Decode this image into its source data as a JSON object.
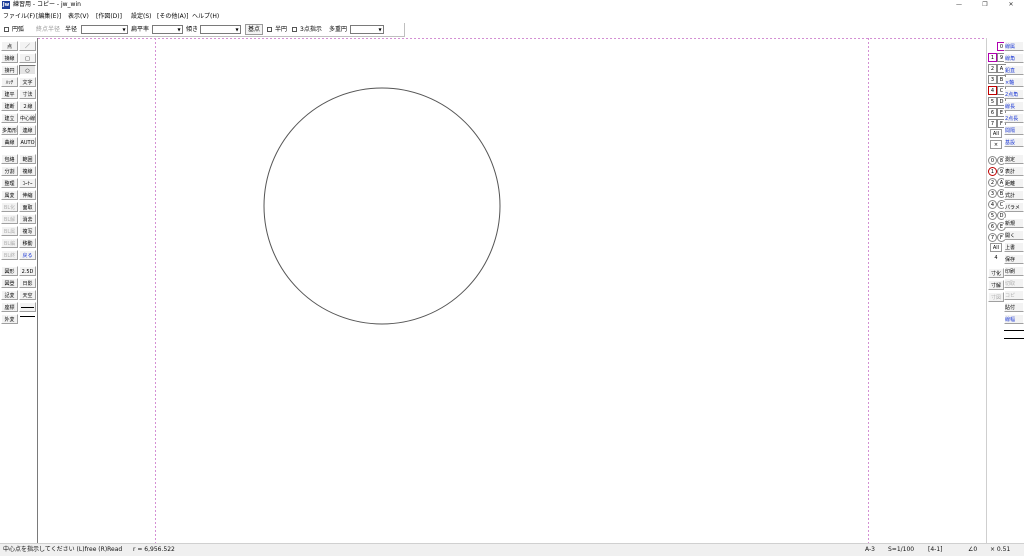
{
  "titlebar": {
    "icon": "Jw",
    "title": "練習用 - コピー - jw_win",
    "minimize": "—",
    "restore": "❐",
    "close": "✕"
  },
  "menu": [
    "ファイル(F)",
    "[編集(E)]",
    "表示(V)",
    "[作図(D)]",
    "設定(S)",
    "[その他(A)]",
    "ヘルプ(H)"
  ],
  "options": {
    "arc": "円弧",
    "end_radius": "終点半径",
    "radius_label": "半径",
    "radius_value": "",
    "flatness_label": "扁平率",
    "flatness_value": "",
    "tilt_label": "傾き",
    "tilt_value": "",
    "base_point": "基点",
    "semicircle": "半円",
    "three_point": "3点指示",
    "multi_circle": "多重円",
    "multi_value": ""
  },
  "left_tools": [
    [
      "点",
      "／"
    ],
    [
      "接線",
      "□"
    ],
    [
      "接円",
      "○"
    ],
    [
      "ﾊｯﾁ",
      "文字"
    ],
    [
      "建平",
      "寸法"
    ],
    [
      "建断",
      "２線"
    ],
    [
      "建立",
      "中心線"
    ],
    [
      "多角形",
      "連線"
    ],
    [
      "曲線",
      "AUTO"
    ],
    [
      "包絡",
      "範囲"
    ],
    [
      "分割",
      "複線"
    ],
    [
      "整理",
      "ｺｰﾅｰ"
    ],
    [
      "属変",
      "伸縮"
    ],
    [
      "BL化",
      "面取"
    ],
    [
      "BL解",
      "消去"
    ],
    [
      "BL属",
      "複写"
    ],
    [
      "BL編",
      "移動"
    ],
    [
      "BL終",
      "戻る"
    ],
    [
      "図形",
      "2.5D"
    ],
    [
      "図登",
      "日影"
    ],
    [
      "記変",
      "天空"
    ],
    [
      "座標",
      ""
    ],
    [
      "外変",
      ""
    ]
  ],
  "right": {
    "layer_group_label": "0",
    "layers": [
      "1",
      "2",
      "3",
      "4",
      "5",
      "6",
      "7"
    ],
    "layer_groups": [
      "9",
      "A",
      "B",
      "C",
      "D",
      "E",
      "F"
    ],
    "all": "All",
    "cross": "×",
    "circles_left": [
      "0",
      "1",
      "2",
      "3",
      "4",
      "5",
      "6",
      "7"
    ],
    "circles_right": [
      "8",
      "9",
      "A",
      "B",
      "C",
      "D",
      "E",
      "F"
    ],
    "all2": "All",
    "num2": "4",
    "bottom": [
      "寸化",
      "寸解",
      "寸図"
    ],
    "tools": [
      "線属",
      "線角",
      "鉛直",
      "×軸",
      "2点角",
      "線長",
      "2点長",
      "間隔",
      "基設",
      "測定",
      "表計",
      "距離",
      "式計",
      "パラメ",
      "新規",
      "開く",
      "上書",
      "保存",
      "印刷",
      "切取",
      "コピ",
      "貼付",
      "線幅"
    ]
  },
  "status": {
    "message": "中心点を指示してください  (L)free  (R)Read",
    "radius": "r = 6,956.522",
    "paper": "A-3",
    "scale": "S=1/100",
    "layer": "[4-1]",
    "angle": "∠0",
    "zoom": "× 0.51"
  },
  "colors": {
    "guide": "#d48fd4",
    "accent_blue": "#1a37d6",
    "titleicon": "#1f3f99"
  }
}
